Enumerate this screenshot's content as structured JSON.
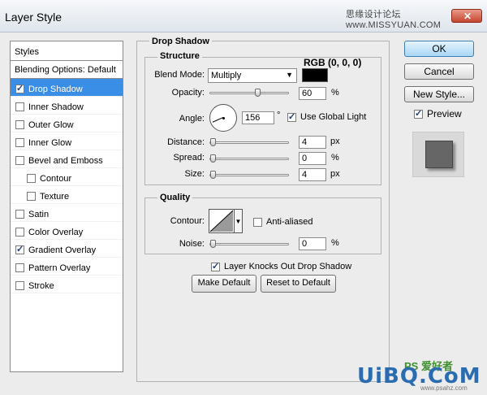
{
  "window": {
    "title": "Layer Style",
    "watermark": "思缘设计论坛  www.MISSYUAN.COM",
    "close_label": "✕"
  },
  "styles_panel": {
    "header": "Styles",
    "blending_default": "Blending Options: Default",
    "items": [
      {
        "label": "Drop Shadow",
        "checked": true,
        "selected": true,
        "sub": false
      },
      {
        "label": "Inner Shadow",
        "checked": false,
        "selected": false,
        "sub": false
      },
      {
        "label": "Outer Glow",
        "checked": false,
        "selected": false,
        "sub": false
      },
      {
        "label": "Inner Glow",
        "checked": false,
        "selected": false,
        "sub": false
      },
      {
        "label": "Bevel and Emboss",
        "checked": false,
        "selected": false,
        "sub": false
      },
      {
        "label": "Contour",
        "checked": false,
        "selected": false,
        "sub": true
      },
      {
        "label": "Texture",
        "checked": false,
        "selected": false,
        "sub": true
      },
      {
        "label": "Satin",
        "checked": false,
        "selected": false,
        "sub": false
      },
      {
        "label": "Color Overlay",
        "checked": false,
        "selected": false,
        "sub": false
      },
      {
        "label": "Gradient Overlay",
        "checked": true,
        "selected": false,
        "sub": false
      },
      {
        "label": "Pattern Overlay",
        "checked": false,
        "selected": false,
        "sub": false
      },
      {
        "label": "Stroke",
        "checked": false,
        "selected": false,
        "sub": false
      }
    ]
  },
  "drop_shadow": {
    "title": "Drop Shadow",
    "structure": {
      "title": "Structure",
      "blend_mode_label": "Blend Mode:",
      "blend_mode_value": "Multiply",
      "shadow_color": "#000000",
      "rgb_annotation": "RGB (0, 0, 0)",
      "opacity_label": "Opacity:",
      "opacity_value": "60",
      "opacity_unit": "%",
      "opacity_fraction": 0.6,
      "angle_label": "Angle:",
      "angle_value": "156",
      "angle_unit": "°",
      "use_global_light_label": "Use Global Light",
      "use_global_light_checked": true,
      "distance_label": "Distance:",
      "distance_value": "4",
      "distance_unit": "px",
      "spread_label": "Spread:",
      "spread_value": "0",
      "spread_unit": "%",
      "size_label": "Size:",
      "size_value": "4",
      "size_unit": "px"
    },
    "quality": {
      "title": "Quality",
      "contour_label": "Contour:",
      "anti_aliased_label": "Anti-aliased",
      "anti_aliased_checked": false,
      "noise_label": "Noise:",
      "noise_value": "0",
      "noise_unit": "%"
    },
    "layer_knocks_out_label": "Layer Knocks Out Drop Shadow",
    "layer_knocks_out_checked": true,
    "make_default_label": "Make Default",
    "reset_default_label": "Reset to Default"
  },
  "buttons": {
    "ok": "OK",
    "cancel": "Cancel",
    "new_style": "New Style..."
  },
  "preview": {
    "label": "Preview",
    "checked": true
  },
  "brand": {
    "ps": "PS 爱好者",
    "logo": "UiBQ.CoM",
    "url": "www.psahz.com"
  }
}
